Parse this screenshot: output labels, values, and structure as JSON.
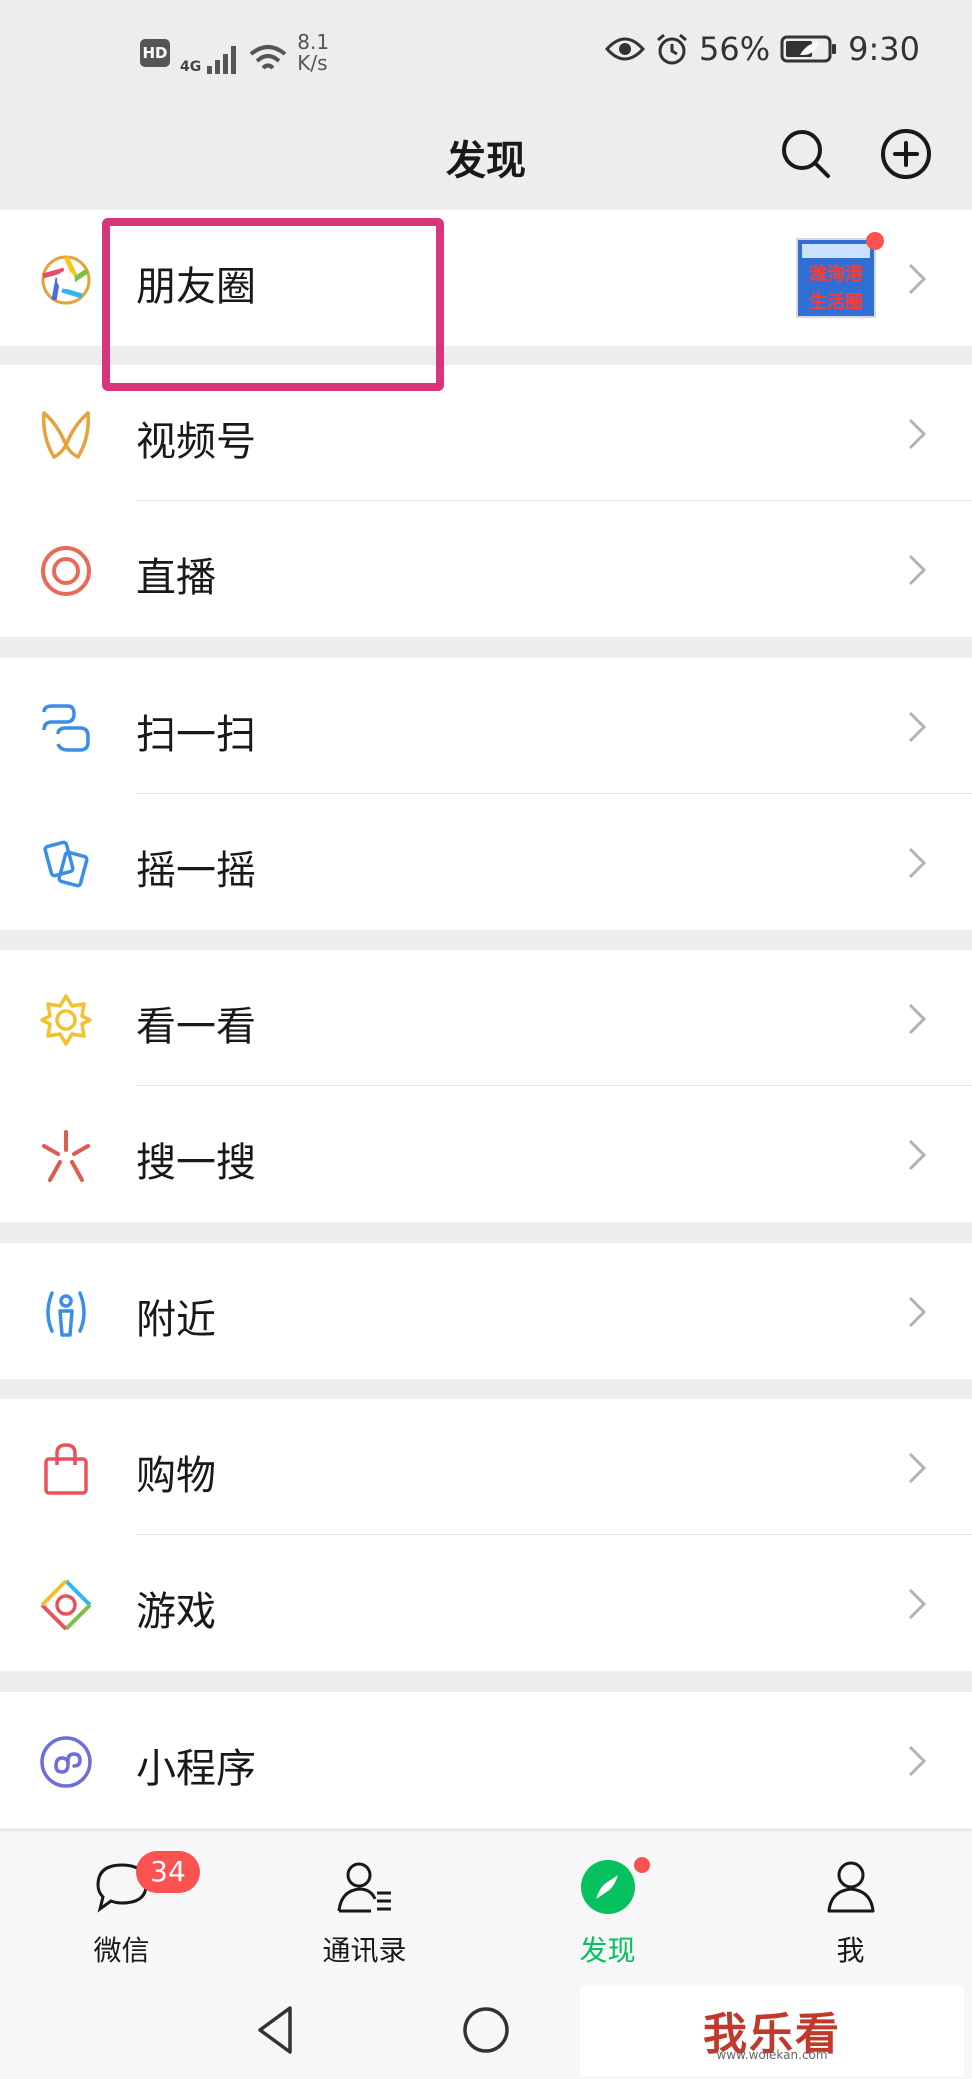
{
  "status_bar": {
    "hd": "HD",
    "network": "4G",
    "speed_value": "8.1",
    "speed_unit": "K/s",
    "battery": "56%",
    "time": "9:30"
  },
  "header": {
    "title": "发现"
  },
  "menu": {
    "moments": "朋友圈",
    "channels": "视频号",
    "live": "直播",
    "scan": "扫一扫",
    "shake": "摇一摇",
    "top_stories": "看一看",
    "search": "搜一搜",
    "nearby": "附近",
    "shopping": "购物",
    "games": "游戏",
    "mini_programs": "小程序"
  },
  "moments_thumb": {
    "line1": "潍洵港",
    "line2": "生活圈"
  },
  "tabbar": {
    "chats": "微信",
    "chats_badge": "34",
    "contacts": "通讯录",
    "discover": "发现",
    "me": "我"
  },
  "watermark": {
    "text": "我乐看",
    "sub": "www.wolekan.com"
  },
  "colors": {
    "accent": "#07c160",
    "badge": "#fa5151",
    "highlight": "#d9357a"
  }
}
